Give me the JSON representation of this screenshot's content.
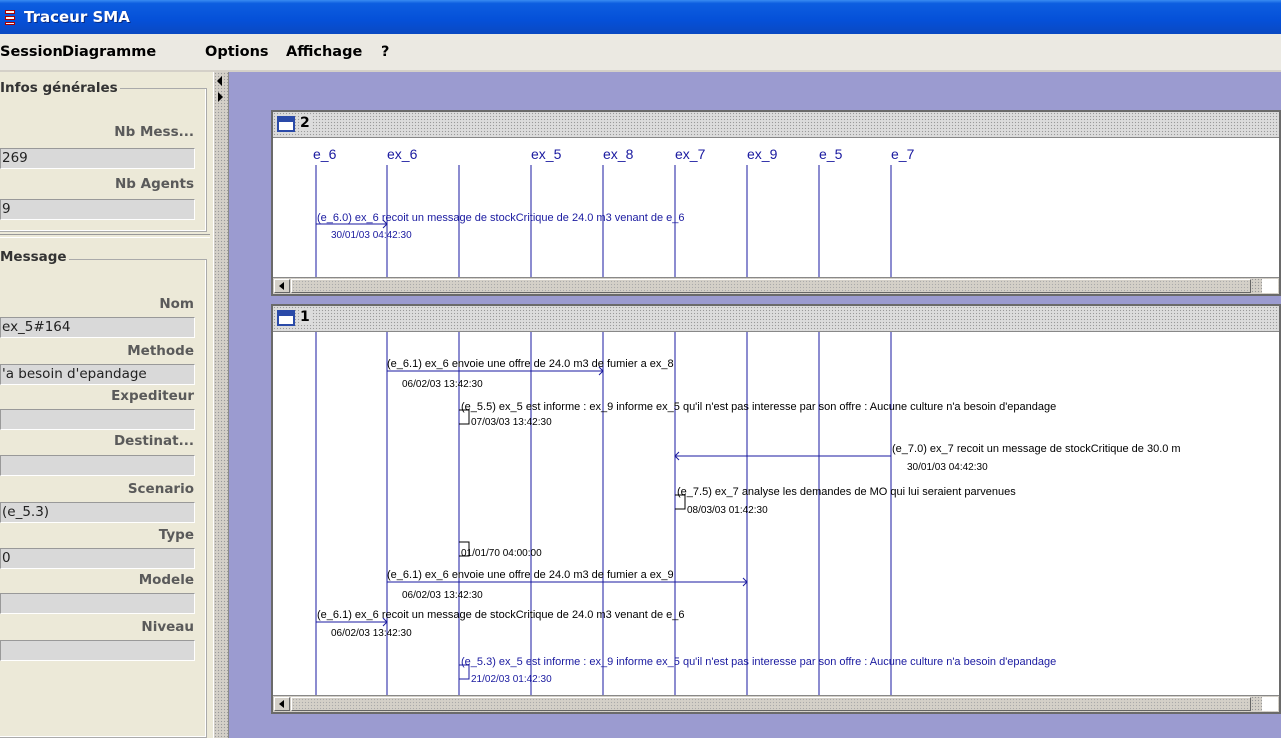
{
  "window": {
    "title": "Traceur SMA"
  },
  "menu": {
    "items": [
      "Session",
      "Diagramme",
      "Options",
      "Affichage",
      "?"
    ]
  },
  "infos": {
    "title": "Infos générales",
    "nb_mess_label": "Nb Mess...",
    "nb_mess_value": "269",
    "nb_agents_label": "Nb Agents",
    "nb_agents_value": "9"
  },
  "message": {
    "title": "Message",
    "fields": [
      {
        "label": "Nom",
        "value": "ex_5#164"
      },
      {
        "label": "Methode",
        "value": "'a besoin d'epandage"
      },
      {
        "label": "Expediteur",
        "value": ""
      },
      {
        "label": "Destinat...",
        "value": ""
      },
      {
        "label": "Scenario",
        "value": "(e_5.3)"
      },
      {
        "label": "Type",
        "value": "0"
      },
      {
        "label": "Modele",
        "value": ""
      },
      {
        "label": "Niveau",
        "value": ""
      }
    ]
  },
  "frame2": {
    "number": "2",
    "agents": [
      "e_6",
      "ex_6",
      "ex_5",
      "ex_8",
      "ex_7",
      "ex_9",
      "e_5",
      "e_7"
    ],
    "messages": [
      {
        "scenario": "(e_6.0)",
        "text": "(e_6.0) ex_6 recoit un message de stockCritique de 24.0 m3 venant de e_6",
        "timestamp": "30/01/03 04:42:30"
      }
    ]
  },
  "frame1": {
    "number": "1",
    "messages": [
      {
        "text": "(e_6.1) ex_6 envoie une offre de 24.0 m3 de fumier a ex_8",
        "timestamp": "06/02/03 13:42:30"
      },
      {
        "text": "(e_5.5) ex_5 est informe : ex_9 informe ex_5 qu'il n'est pas interesse par son offre : Aucune culture n'a besoin d'epandage",
        "timestamp": "07/03/03 13:42:30"
      },
      {
        "text": "(e_7.0) ex_7 recoit un message de stockCritique de 30.0 m",
        "timestamp": "30/01/03 04:42:30"
      },
      {
        "text": "(e_7.5) ex_7 analyse les demandes de MO qui lui seraient parvenues",
        "timestamp": "08/03/03 01:42:30"
      },
      {
        "text": "",
        "timestamp": "01/01/70 04:00:00"
      },
      {
        "text": "(e_6.1) ex_6 envoie une offre de 24.0 m3 de fumier a ex_9",
        "timestamp": "06/02/03 13:42:30"
      },
      {
        "text": "(e_6.1) ex_6 recoit un message de stockCritique de 24.0 m3 venant de e_6",
        "timestamp": "06/02/03 13:42:30"
      },
      {
        "text": "(e_5.3) ex_5 est informe : ex_9 informe ex_5 qu'il n'est pas interesse par son offre : Aucune culture n'a besoin d'epandage",
        "timestamp": "21/02/03 01:42:30"
      }
    ]
  },
  "colors": {
    "titlebar": "#0550d8",
    "desktop": "#9b9bd0",
    "lifeline": "#1a1aa0"
  }
}
